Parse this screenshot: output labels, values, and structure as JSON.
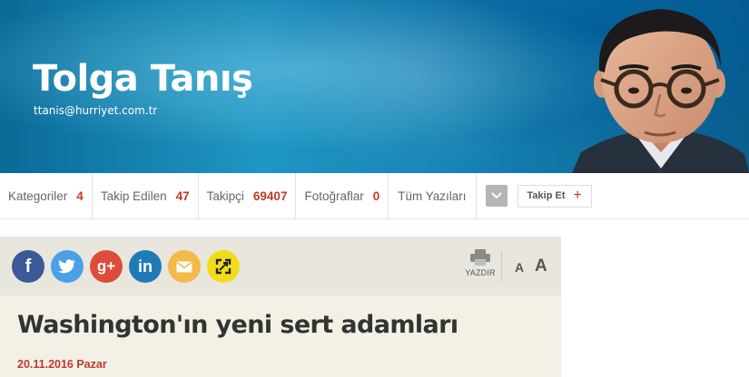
{
  "header": {
    "author_name": "Tolga Tanış",
    "author_email": "ttanis@hurriyet.com.tr"
  },
  "tabs": [
    {
      "label": "Kategoriler",
      "count": "4"
    },
    {
      "label": "Takip Edilen",
      "count": "47"
    },
    {
      "label": "Takipçi",
      "count": "69407"
    },
    {
      "label": "Fotoğraflar",
      "count": "0"
    },
    {
      "label": "Tüm Yazıları",
      "count": ""
    }
  ],
  "follow_button": {
    "label": "Takip Et",
    "icon": "plus-icon"
  },
  "share": {
    "icons": [
      "facebook-icon",
      "twitter-icon",
      "google-plus-icon",
      "linkedin-icon",
      "email-icon",
      "expand-icon"
    ],
    "colors": {
      "facebook": "#3b5998",
      "twitter": "#4ca0e6",
      "google_plus": "#dd4b39",
      "linkedin": "#1f7ab8",
      "email": "#f5b948",
      "expand": "#f2dc1a"
    },
    "print_label": "YAZDIR",
    "font_small": "A",
    "font_large": "A"
  },
  "article": {
    "title": "Washington'ın yeni sert adamları",
    "date": "20.11.2016 Pazar"
  },
  "colors": {
    "accent": "#c0392b",
    "banner_blue": "#1583b5"
  }
}
